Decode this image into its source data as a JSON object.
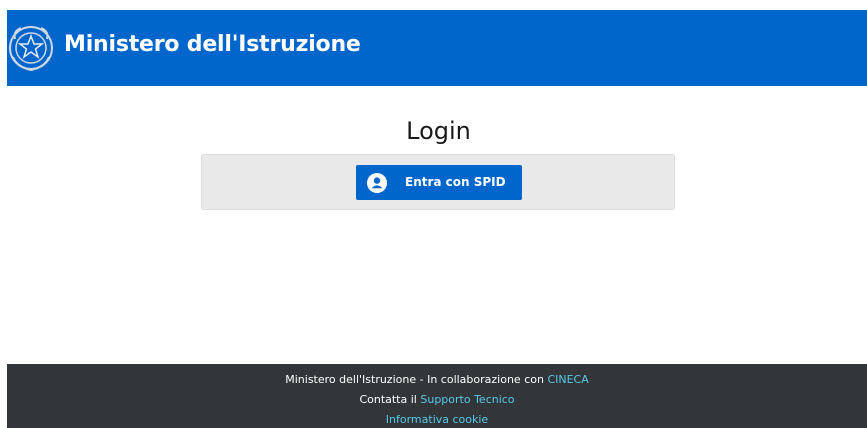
{
  "header": {
    "title": "Ministero dell'Istruzione",
    "emblem_icon": "italian-republic-emblem-icon",
    "background": "#0066cc"
  },
  "login": {
    "title": "Login",
    "spid_button_label": "Entra con SPID",
    "spid_icon": "user-circle-icon"
  },
  "footer": {
    "line1_text": "Ministero dell'Istruzione - In collaborazione con ",
    "line1_link": "CINECA",
    "line2_text": "Contatta il ",
    "line2_link": "Supporto Tecnico",
    "line3_link": "Informativa cookie",
    "background": "#323639",
    "link_color": "#57c9e8"
  }
}
